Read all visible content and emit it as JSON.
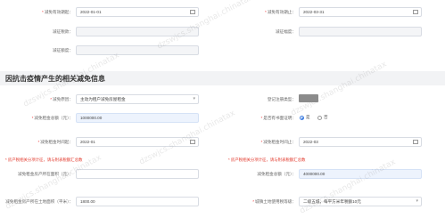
{
  "row1": {
    "left_label": "减免有效期起：",
    "left_value": "2022-01-01",
    "right_label": "减免有效期止：",
    "right_value": "2022-03-31"
  },
  "row2": {
    "left_label": "减征税款：",
    "right_label": "减征幅度："
  },
  "row3": {
    "left_label": "减征额度："
  },
  "section": {
    "title": "因抗击疫情产生的相关减免信息"
  },
  "rowA": {
    "left_label": "减免原因：",
    "left_value": "主动为租户减免房屋租金",
    "right_label": "登记注册类型："
  },
  "rowB": {
    "left_label": "减免租金总额（元）：",
    "left_value": "1000000.00",
    "right_label": "是否有书面证明：",
    "radio_yes": "是",
    "radio_no": "否"
  },
  "rowC": {
    "left_label": "减免租金时间起：",
    "left_value": "2022-01",
    "right_label": "减免租金时间止：",
    "right_value": "2022-03"
  },
  "warnings": {
    "left": "* 房产税相关分项计征，请与附表税额汇总数",
    "right": "* 房产税相关分项计征，请与附表税额汇总数"
  },
  "rowD": {
    "left_label": "减免租金房产所在面积（元）：",
    "right_label": "减免租金总额（元）：",
    "right_value": "4000000.00"
  },
  "rowE": {
    "left_label": "减免租金房产所在土地面积（平米）：",
    "left_value": "1800.00",
    "right_label": "城镇土地使用税等级：",
    "right_value": "二级五城，每平方米年税额10元"
  },
  "watermark": {
    "text": "dzswjcs.shanghai.chinatax"
  },
  "colors": {
    "input_border": "#d8dce3",
    "highlight_bg": "#edf3fd",
    "warning": "#e23b2e",
    "section_bg": "#f2f3f5"
  }
}
